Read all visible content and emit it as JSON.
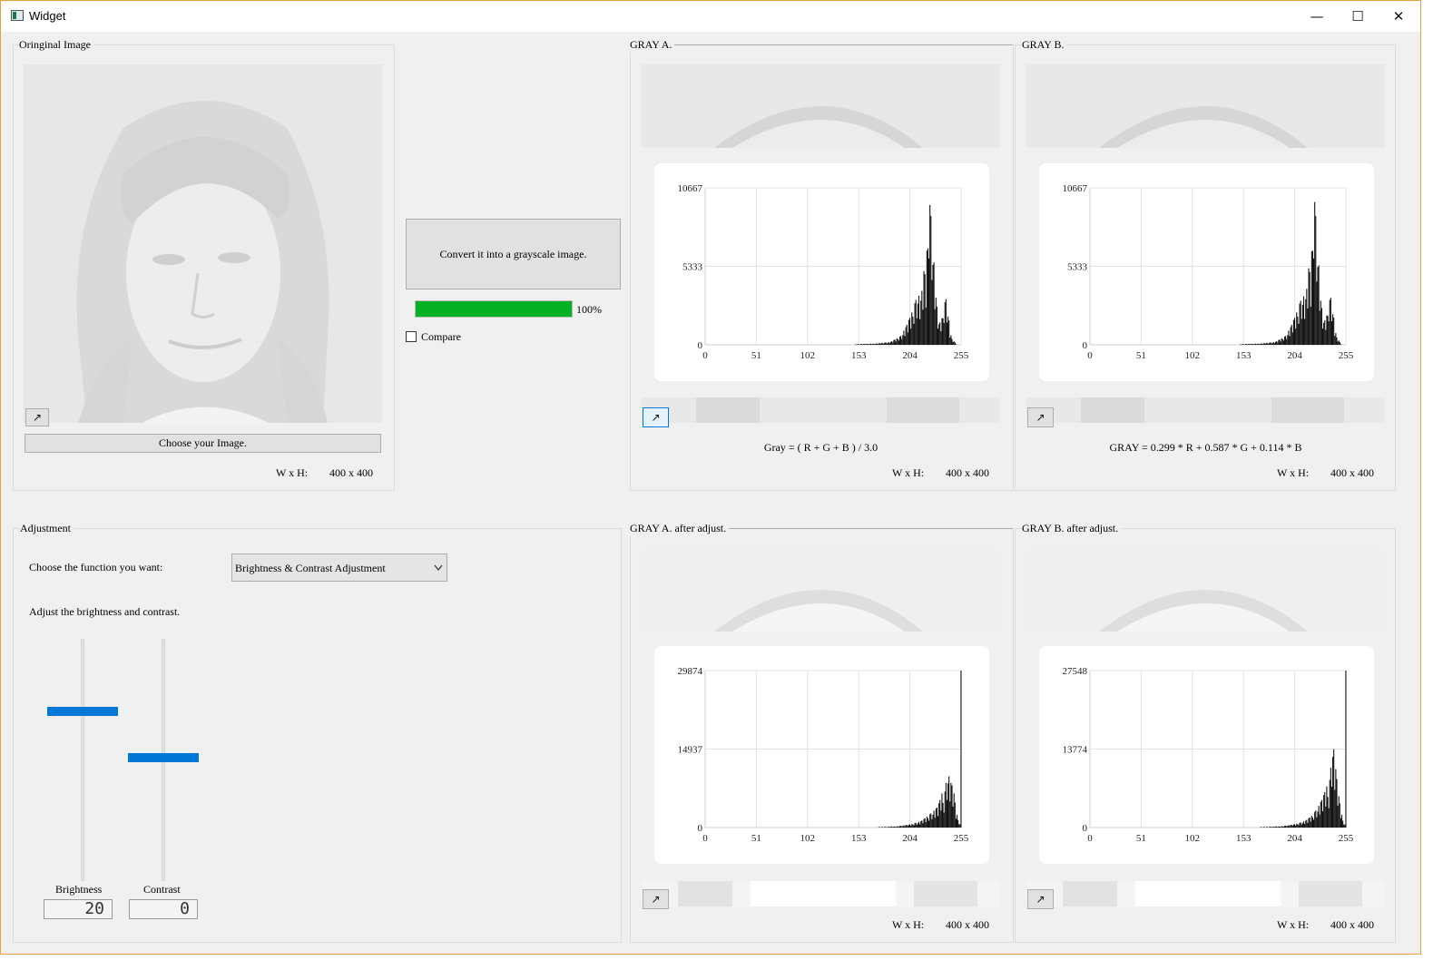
{
  "window": {
    "title": "Widget",
    "minimize_icon": "minimize-icon",
    "maximize_icon": "maximize-icon",
    "close_icon": "close-icon",
    "minimize_glyph": "—",
    "maximize_glyph": "☐",
    "close_glyph": "✕"
  },
  "original": {
    "group_label": "Oringinal Image",
    "popout_glyph": "↗",
    "choose_button": "Choose your Image.",
    "wh_label": "W x H:",
    "wh_value": "400 x 400"
  },
  "convert": {
    "button_label": "Convert it into a grayscale image.",
    "progress": 100,
    "progress_text": "100%",
    "progress_color": "#06b025",
    "compare_label": "Compare",
    "compare_checked": false
  },
  "gray_a": {
    "group_label": "GRAY A.",
    "formula": "Gray = ( R + G + B ) / 3.0",
    "wh_label": "W x H:",
    "wh_value": "400 x 400",
    "popout_glyph": "↗"
  },
  "gray_b": {
    "group_label": "GRAY B.",
    "formula": "GRAY = 0.299 * R + 0.587 * G + 0.114 * B",
    "wh_label": "W x H:",
    "wh_value": "400 x 400",
    "popout_glyph": "↗"
  },
  "gray_a_adj": {
    "group_label": "GRAY A. after adjust.",
    "wh_label": "W x H:",
    "wh_value": "400 x 400",
    "popout_glyph": "↗"
  },
  "gray_b_adj": {
    "group_label": "GRAY B. after adjust.",
    "wh_label": "W x H:",
    "wh_value": "400 x 400",
    "popout_glyph": "↗"
  },
  "adjustment": {
    "group_label": "Adjustment",
    "choose_label": "Choose the function you want:",
    "function_selected": "Brightness & Contrast Adjustment",
    "hint": "Adjust the brightness and contrast.",
    "brightness_label": "Brightness",
    "brightness_value": "20",
    "contrast_label": "Contrast",
    "contrast_value": "0",
    "brightness_level": 0.71,
    "contrast_level": 0.51,
    "accent": "#0078d7"
  },
  "chart_data": [
    {
      "type": "bar",
      "name": "gray_a",
      "xlim": [
        0,
        255
      ],
      "ylim": [
        0,
        10667
      ],
      "x_ticks": [
        "0",
        "51",
        "102",
        "153",
        "204",
        "255"
      ],
      "y_ticks": [
        "0",
        "5333",
        "10667"
      ],
      "peaks": [
        [
          150,
          50
        ],
        [
          170,
          80
        ],
        [
          185,
          200
        ],
        [
          195,
          600
        ],
        [
          200,
          1200
        ],
        [
          205,
          2000
        ],
        [
          208,
          2600
        ],
        [
          212,
          3500
        ],
        [
          215,
          3000
        ],
        [
          218,
          5000
        ],
        [
          220,
          4600
        ],
        [
          222,
          8200
        ],
        [
          223,
          10667
        ],
        [
          224,
          9500
        ],
        [
          226,
          8000
        ],
        [
          228,
          5600
        ],
        [
          230,
          3200
        ],
        [
          233,
          1400
        ],
        [
          236,
          1800
        ],
        [
          238,
          2700
        ],
        [
          240,
          3100
        ],
        [
          242,
          2400
        ],
        [
          244,
          900
        ],
        [
          246,
          400
        ],
        [
          250,
          80
        ]
      ]
    },
    {
      "type": "bar",
      "name": "gray_b",
      "xlim": [
        0,
        255
      ],
      "ylim": [
        0,
        10667
      ],
      "x_ticks": [
        "0",
        "51",
        "102",
        "153",
        "204",
        "255"
      ],
      "y_ticks": [
        "0",
        "5333",
        "10667"
      ],
      "peaks": [
        [
          150,
          50
        ],
        [
          170,
          80
        ],
        [
          185,
          200
        ],
        [
          195,
          600
        ],
        [
          200,
          1200
        ],
        [
          205,
          2000
        ],
        [
          208,
          2600
        ],
        [
          212,
          3400
        ],
        [
          215,
          3100
        ],
        [
          218,
          5200
        ],
        [
          220,
          4700
        ],
        [
          222,
          8000
        ],
        [
          223,
          10667
        ],
        [
          224,
          9700
        ],
        [
          226,
          7800
        ],
        [
          228,
          5400
        ],
        [
          230,
          3000
        ],
        [
          233,
          1500
        ],
        [
          236,
          2000
        ],
        [
          238,
          2900
        ],
        [
          240,
          3200
        ],
        [
          242,
          2600
        ],
        [
          244,
          1100
        ],
        [
          246,
          500
        ],
        [
          250,
          90
        ]
      ]
    },
    {
      "type": "bar",
      "name": "gray_a_adj",
      "xlim": [
        0,
        255
      ],
      "ylim": [
        0,
        29874
      ],
      "x_ticks": [
        "0",
        "51",
        "102",
        "153",
        "204",
        "255"
      ],
      "y_ticks": [
        "0",
        "14937",
        "29874"
      ],
      "peaks": [
        [
          170,
          80
        ],
        [
          190,
          200
        ],
        [
          205,
          600
        ],
        [
          215,
          1200
        ],
        [
          222,
          2200
        ],
        [
          228,
          3200
        ],
        [
          232,
          4000
        ],
        [
          236,
          6500
        ],
        [
          238,
          5200
        ],
        [
          240,
          8500
        ],
        [
          242,
          10500
        ],
        [
          244,
          9000
        ],
        [
          246,
          8000
        ],
        [
          248,
          6500
        ],
        [
          250,
          3000
        ],
        [
          252,
          1800
        ],
        [
          254,
          600
        ],
        [
          255,
          29874
        ]
      ]
    },
    {
      "type": "bar",
      "name": "gray_b_adj",
      "xlim": [
        0,
        255
      ],
      "ylim": [
        0,
        27548
      ],
      "x_ticks": [
        "0",
        "51",
        "102",
        "153",
        "204",
        "255"
      ],
      "y_ticks": [
        "0",
        "13774",
        "27548"
      ],
      "peaks": [
        [
          170,
          80
        ],
        [
          190,
          200
        ],
        [
          205,
          600
        ],
        [
          215,
          1200
        ],
        [
          222,
          2200
        ],
        [
          228,
          3800
        ],
        [
          232,
          5200
        ],
        [
          236,
          7200
        ],
        [
          238,
          6200
        ],
        [
          240,
          10500
        ],
        [
          242,
          15500
        ],
        [
          244,
          12000
        ],
        [
          246,
          8500
        ],
        [
          248,
          5500
        ],
        [
          250,
          3000
        ],
        [
          252,
          1500
        ],
        [
          254,
          500
        ],
        [
          255,
          27548
        ]
      ]
    }
  ]
}
